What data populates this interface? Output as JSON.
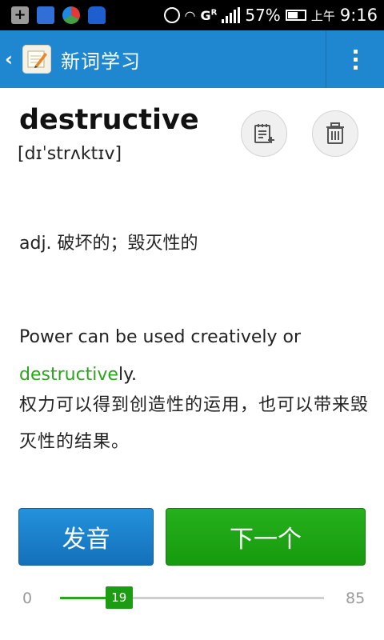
{
  "status_bar": {
    "battery_text": "57%",
    "ampm": "上午",
    "time": "9:16",
    "network": "G",
    "network_sub": "R"
  },
  "title_bar": {
    "back_glyph": "‹",
    "title": "新词学习"
  },
  "word": {
    "headword": "destructive",
    "phonetic": "[dɪˈstrʌktɪv]",
    "definition": "adj. 破坏的；毁灭性的"
  },
  "example": {
    "prefix": "Power can be used creatively or ",
    "highlight": "destructive",
    "suffix": "ly.",
    "translation": "权力可以得到创造性的运用，也可以带来毁灭性的结果。"
  },
  "buttons": {
    "pronounce": "发音",
    "next": "下一个"
  },
  "progress": {
    "min": "0",
    "max": "85",
    "current": "19",
    "current_value": 19,
    "max_value": 85
  },
  "colors": {
    "titlebar": "#1f86d0",
    "pronounce_button": "#1b82cc",
    "next_button": "#1fa816",
    "highlight_text": "#2aa51a",
    "progress_fill": "#2aa51a"
  }
}
